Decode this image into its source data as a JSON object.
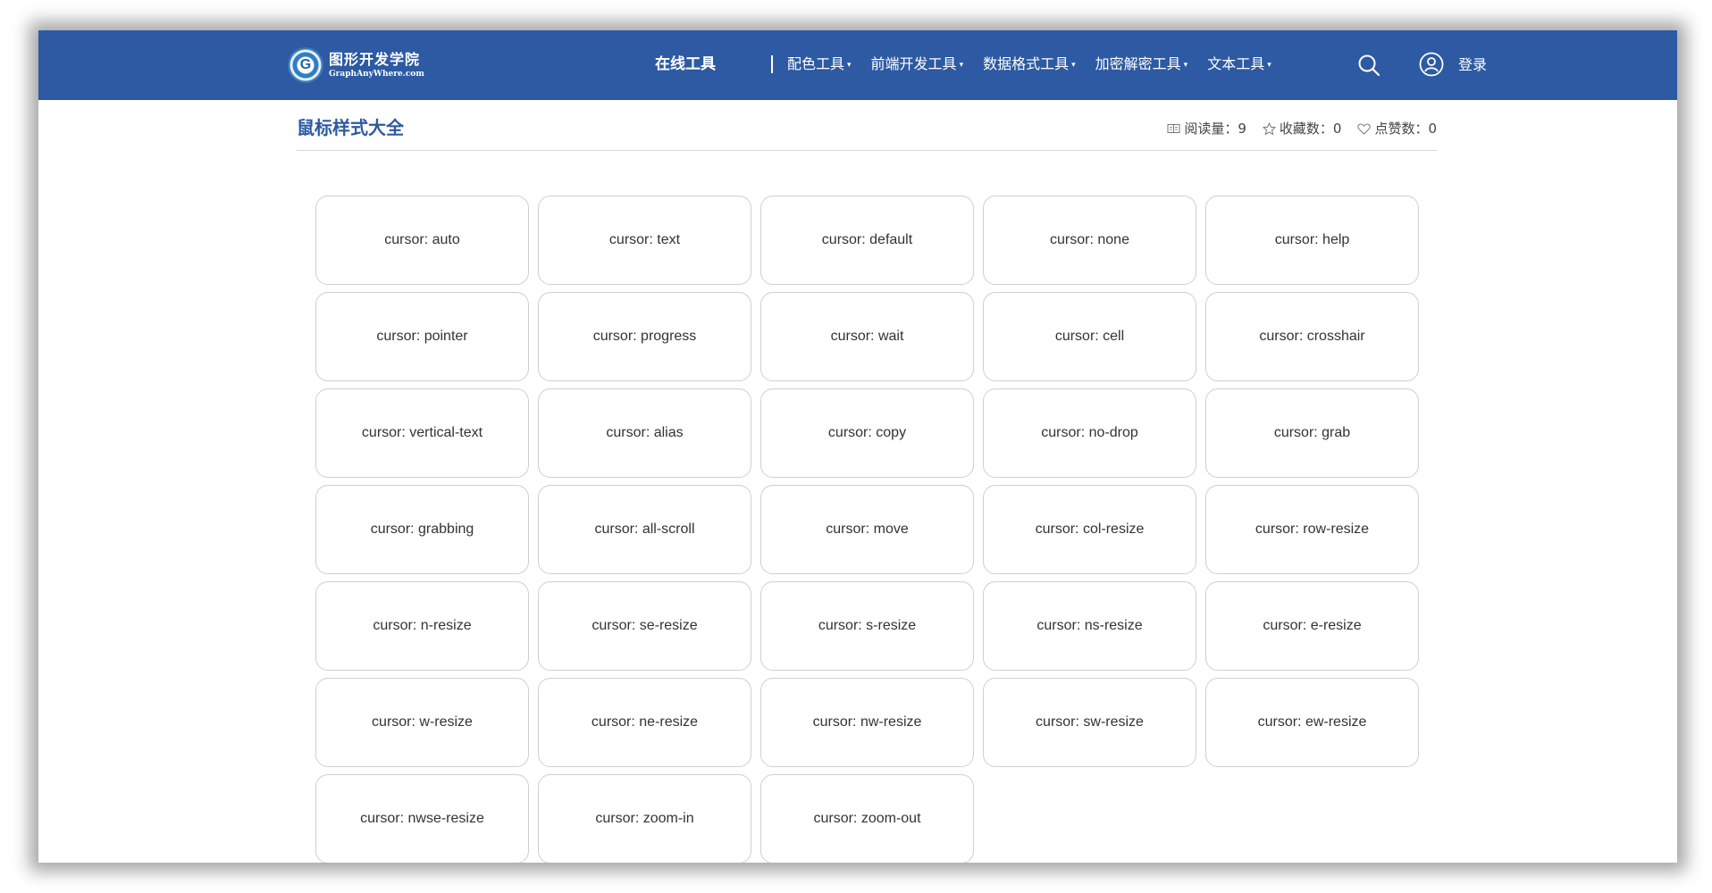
{
  "header": {
    "logo_cn": "图形开发学院",
    "logo_en": "GraphAnyWhere.com",
    "logo_badge": "G",
    "nav_main": "在线工具",
    "nav_items": [
      {
        "label": "配色工具"
      },
      {
        "label": "前端开发工具"
      },
      {
        "label": "数据格式工具"
      },
      {
        "label": "加密解密工具"
      },
      {
        "label": "文本工具"
      }
    ],
    "caret": "▾",
    "login_label": "登录",
    "icons": [
      "search-icon",
      "user-icon"
    ]
  },
  "page": {
    "title": "鼠标样式大全",
    "stats": {
      "reads": "阅读量：9",
      "favorites": "收藏数：0",
      "likes": "点赞数：0"
    }
  },
  "cursors": [
    "cursor: auto",
    "cursor: text",
    "cursor: default",
    "cursor: none",
    "cursor: help",
    "cursor: pointer",
    "cursor: progress",
    "cursor: wait",
    "cursor: cell",
    "cursor: crosshair",
    "cursor: vertical-text",
    "cursor: alias",
    "cursor: copy",
    "cursor: no-drop",
    "cursor: grab",
    "cursor: grabbing",
    "cursor: all-scroll",
    "cursor: move",
    "cursor: col-resize",
    "cursor: row-resize",
    "cursor: n-resize",
    "cursor: se-resize",
    "cursor: s-resize",
    "cursor: ns-resize",
    "cursor: e-resize",
    "cursor: w-resize",
    "cursor: ne-resize",
    "cursor: nw-resize",
    "cursor: sw-resize",
    "cursor: ew-resize",
    "cursor: nwse-resize",
    "cursor: zoom-in",
    "cursor: zoom-out"
  ],
  "colors": {
    "header_bg": "#2d5aa2",
    "title": "#2d5aa2",
    "cell_border": "#cfcfcf"
  }
}
